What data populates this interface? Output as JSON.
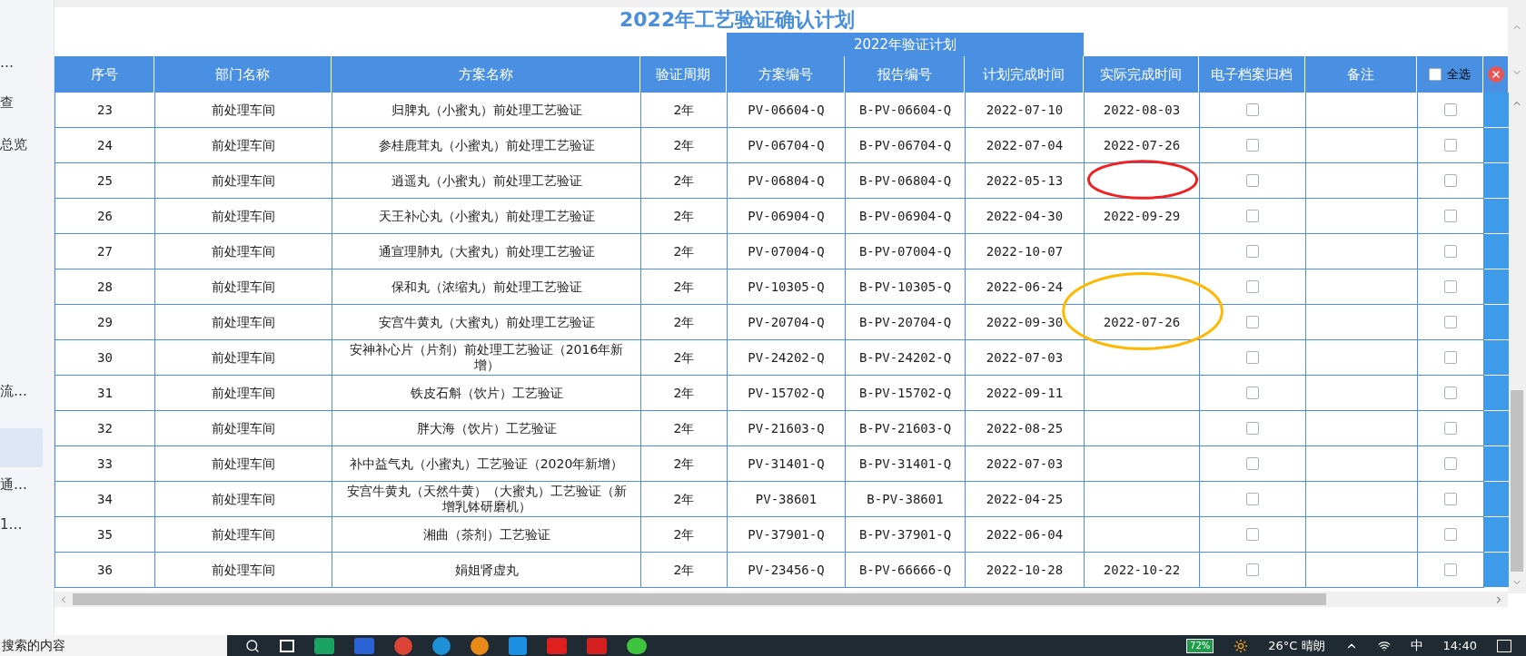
{
  "sidebar": {
    "items": [
      {
        "label": "…",
        "selected": false
      },
      {
        "label": "查",
        "selected": false
      },
      {
        "label": "总览",
        "selected": false
      },
      {
        "label": "流…",
        "selected": false
      },
      {
        "selected": true
      },
      {
        "label": "通…",
        "selected": false
      },
      {
        "label": "1…",
        "selected": false
      }
    ]
  },
  "title": "2022年工艺验证确认计划",
  "group_header": "2022年验证计划",
  "table": {
    "columns": [
      "序号",
      "部门名称",
      "方案名称",
      "验证周期",
      "方案编号",
      "报告编号",
      "计划完成时间",
      "实际完成时间",
      "电子档案归档",
      "备注"
    ],
    "select_all": {
      "label": "全选",
      "checked": false
    },
    "rows": [
      {
        "no": "23",
        "dept": "前处理车间",
        "plan": "归脾丸（小蜜丸）前处理工艺验证",
        "cycle": "2年",
        "plan_code": "PV-06604-Q",
        "report_code": "B-PV-06604-Q",
        "planned": "2022-07-10",
        "actual": "2022-08-03",
        "archived": false,
        "checked": false
      },
      {
        "no": "24",
        "dept": "前处理车间",
        "plan": "参桂鹿茸丸（小蜜丸）前处理工艺验证",
        "cycle": "2年",
        "plan_code": "PV-06704-Q",
        "report_code": "B-PV-06704-Q",
        "planned": "2022-07-04",
        "actual": "2022-07-26",
        "archived": false,
        "checked": false
      },
      {
        "no": "25",
        "dept": "前处理车间",
        "plan": "逍遥丸（小蜜丸）前处理工艺验证",
        "cycle": "2年",
        "plan_code": "PV-06804-Q",
        "report_code": "B-PV-06804-Q",
        "planned": "2022-05-13",
        "archived": false,
        "checked": false,
        "circle": {
          "kind": "small",
          "color": "#ee2222"
        }
      },
      {
        "no": "26",
        "dept": "前处理车间",
        "plan": "天王补心丸（小蜜丸）前处理工艺验证",
        "cycle": "2年",
        "plan_code": "PV-06904-Q",
        "report_code": "B-PV-06904-Q",
        "planned": "2022-04-30",
        "actual": "2022-09-29",
        "archived": false,
        "checked": false
      },
      {
        "no": "27",
        "dept": "前处理车间",
        "plan": "通宣理肺丸（大蜜丸）前处理工艺验证",
        "cycle": "2年",
        "plan_code": "PV-07004-Q",
        "report_code": "B-PV-07004-Q",
        "planned": "2022-10-07",
        "archived": false,
        "checked": false
      },
      {
        "no": "28",
        "dept": "前处理车间",
        "plan": "保和丸（浓缩丸）前处理工艺验证",
        "cycle": "2年",
        "plan_code": "PV-10305-Q",
        "report_code": "B-PV-10305-Q",
        "planned": "2022-06-24",
        "archived": false,
        "checked": false
      },
      {
        "no": "29",
        "dept": "前处理车间",
        "plan": "安宫牛黄丸（大蜜丸）前处理工艺验证",
        "cycle": "2年",
        "plan_code": "PV-20704-Q",
        "report_code": "B-PV-20704-Q",
        "planned": "2022-09-30",
        "actual": "2022-07-26",
        "archived": false,
        "checked": false,
        "circle": {
          "kind": "large",
          "color": "#ffb800"
        }
      },
      {
        "no": "30",
        "dept": "前处理车间",
        "plan": "安神补心片（片剂）前处理工艺验证（2016年新增）",
        "cycle": "2年",
        "plan_code": "PV-24202-Q",
        "report_code": "B-PV-24202-Q",
        "planned": "2022-07-03",
        "archived": false,
        "checked": false
      },
      {
        "no": "31",
        "dept": "前处理车间",
        "plan": "铁皮石斛（饮片）工艺验证",
        "cycle": "2年",
        "plan_code": "PV-15702-Q",
        "report_code": "B-PV-15702-Q",
        "planned": "2022-09-11",
        "archived": false,
        "checked": false
      },
      {
        "no": "32",
        "dept": "前处理车间",
        "plan": "胖大海（饮片）工艺验证",
        "cycle": "2年",
        "plan_code": "PV-21603-Q",
        "report_code": "B-PV-21603-Q",
        "planned": "2022-08-25",
        "archived": false,
        "checked": false
      },
      {
        "no": "33",
        "dept": "前处理车间",
        "plan": "补中益气丸（小蜜丸）工艺验证（2020年新增）",
        "cycle": "2年",
        "plan_code": "PV-31401-Q",
        "report_code": "B-PV-31401-Q",
        "planned": "2022-07-03",
        "archived": false,
        "checked": false
      },
      {
        "no": "34",
        "dept": "前处理车间",
        "plan": "安宫牛黄丸（天然牛黄）（大蜜丸）工艺验证（新增乳钵研磨机）",
        "cycle": "2年",
        "plan_code": "PV-38601",
        "report_code": "B-PV-38601",
        "planned": "2022-04-25",
        "archived": false,
        "checked": false
      },
      {
        "no": "35",
        "dept": "前处理车间",
        "plan": "湘曲（茶剂）工艺验证",
        "cycle": "2年",
        "plan_code": "PV-37901-Q",
        "report_code": "B-PV-37901-Q",
        "planned": "2022-06-04",
        "archived": false,
        "checked": false
      },
      {
        "no": "36",
        "dept": "前处理车间",
        "plan": "娟姐肾虚丸",
        "cycle": "2年",
        "plan_code": "PV-23456-Q",
        "report_code": "B-PV-66666-Q",
        "planned": "2022-10-28",
        "actual": "2022-10-22",
        "archived": false,
        "checked": false
      }
    ]
  },
  "search_hint": "搜索的内容",
  "taskbar": {
    "battery": "72%",
    "weather": "26°C 晴朗",
    "ime": "中",
    "time": "14:40"
  }
}
